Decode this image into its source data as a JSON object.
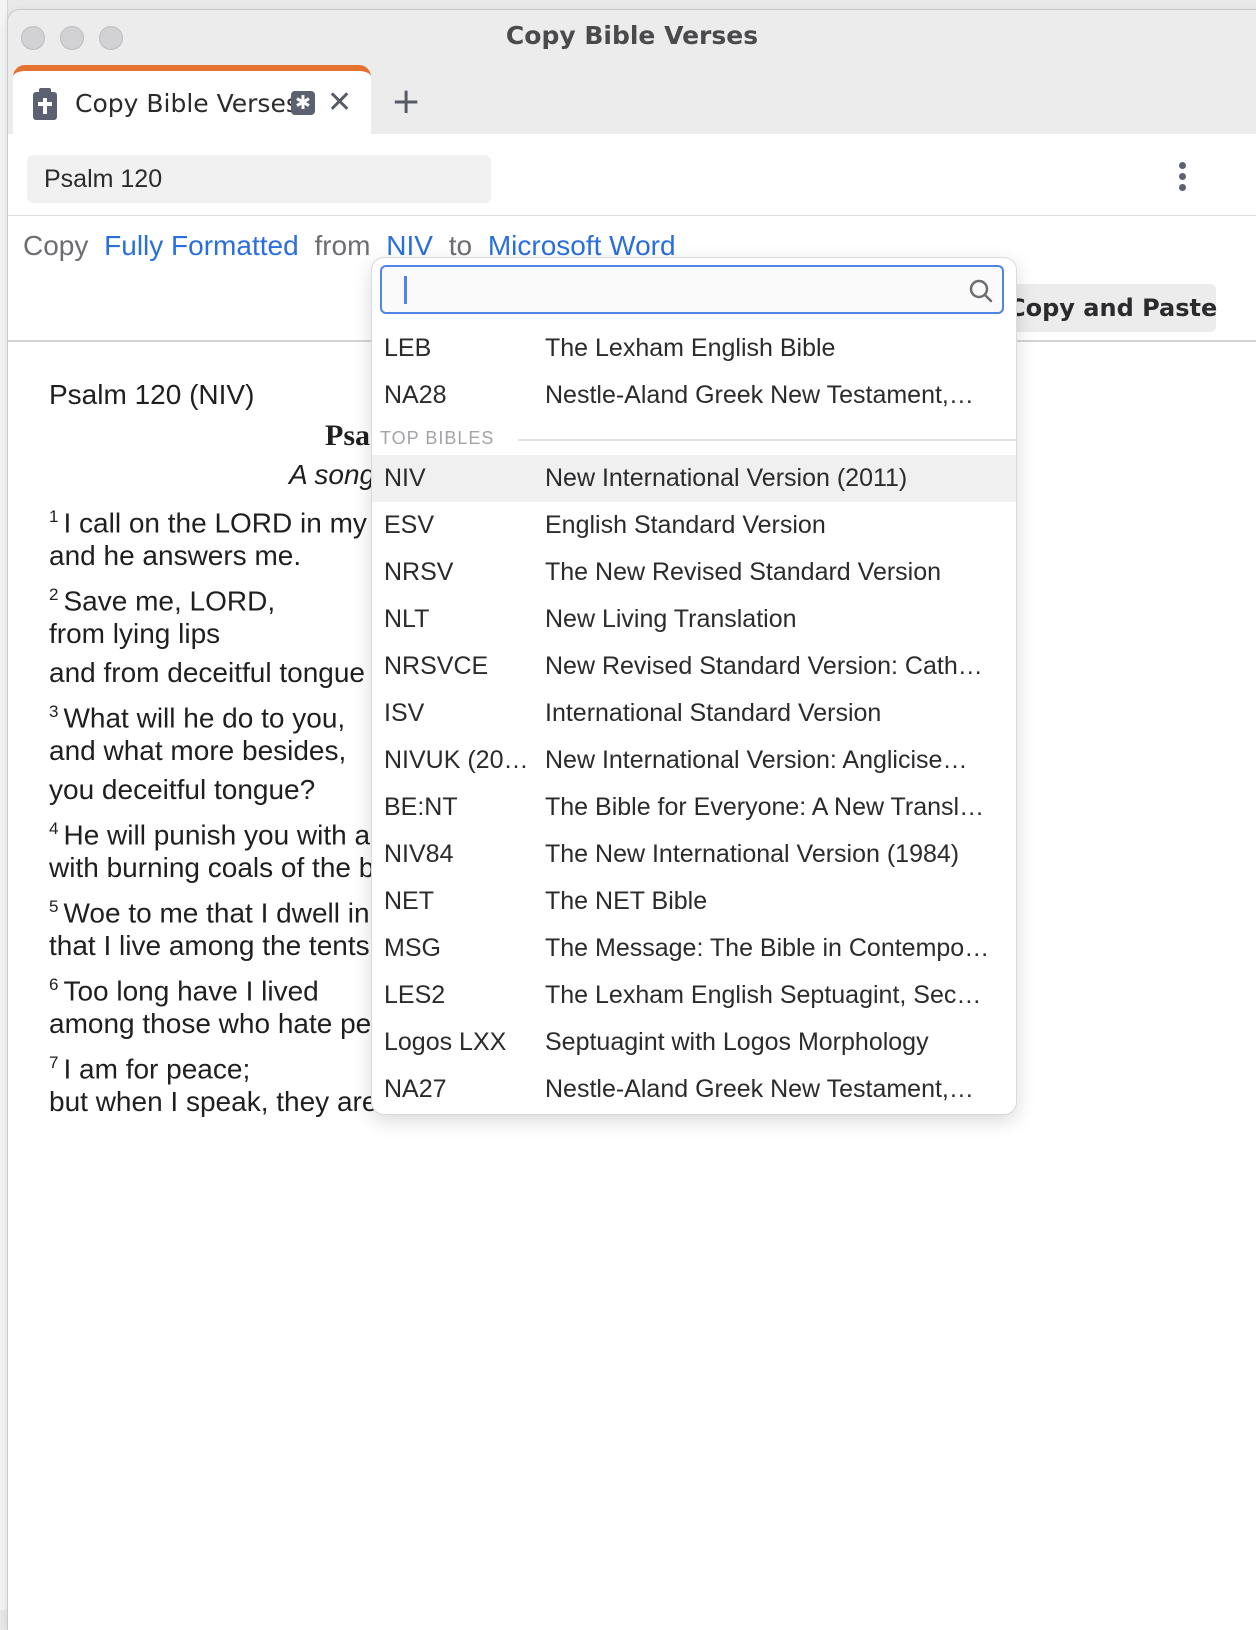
{
  "window": {
    "title": "Copy Bible Verses"
  },
  "tab": {
    "label": "Copy Bible Verses",
    "star_glyph": "✱",
    "close_glyph": "✕",
    "add_glyph": "+"
  },
  "reference_input": {
    "value": "Psalm 120"
  },
  "copy_sentence": {
    "copy": "Copy",
    "format": "Fully Formatted",
    "from": "from",
    "bible": "NIV",
    "to": "to",
    "target": "Microsoft Word"
  },
  "copy_paste_button": "Copy and Paste",
  "preview": {
    "reference": "Psalm 120 (NIV)",
    "heading": "Psa",
    "subtitle": "A song",
    "verses": [
      {
        "num": "1",
        "text": "I call on the LORD in my d"
      },
      {
        "num": "",
        "text": "and he answers me."
      },
      {
        "num": "2",
        "text": "Save me, LORD,"
      },
      {
        "num": "",
        "text": "from lying lips"
      },
      {
        "num": "",
        "text": "and from deceitful tongue"
      },
      {
        "num": "3",
        "text": "What will he do to you,"
      },
      {
        "num": "",
        "text": "and what more besides,"
      },
      {
        "num": "",
        "text": "you deceitful tongue?"
      },
      {
        "num": "4",
        "text": "He will punish you with a"
      },
      {
        "num": "",
        "text": "with burning coals of the b"
      },
      {
        "num": "5",
        "text": "Woe to me that I dwell in"
      },
      {
        "num": "",
        "text": "that I live among the tents"
      },
      {
        "num": "6",
        "text": "Too long have I lived"
      },
      {
        "num": "",
        "text": "among those who hate pe"
      },
      {
        "num": "7",
        "text": "I am for peace;"
      },
      {
        "num": "",
        "text": "but when I speak, they are"
      }
    ]
  },
  "dropdown": {
    "search_value": "",
    "recent": [
      {
        "abbrev": "LEB",
        "name": "The Lexham English Bible"
      },
      {
        "abbrev": "NA28",
        "name": "Nestle-Aland Greek New Testament,…"
      }
    ],
    "section_label": "TOP BIBLES",
    "top_bibles": [
      {
        "abbrev": "NIV",
        "name": "New International Version (2011)",
        "selected": true
      },
      {
        "abbrev": "ESV",
        "name": "English Standard Version"
      },
      {
        "abbrev": "NRSV",
        "name": "The New Revised Standard Version"
      },
      {
        "abbrev": "NLT",
        "name": "New Living Translation"
      },
      {
        "abbrev": "NRSVCE",
        "name": "New Revised Standard Version: Cath…"
      },
      {
        "abbrev": "ISV",
        "name": "International Standard Version"
      },
      {
        "abbrev": "NIVUK (20…",
        "name": "New International Version: Anglicise…"
      },
      {
        "abbrev": "BE:NT",
        "name": "The Bible for Everyone: A New Transl…"
      },
      {
        "abbrev": "NIV84",
        "name": "The New International Version (1984)"
      },
      {
        "abbrev": "NET",
        "name": "The NET Bible"
      },
      {
        "abbrev": "MSG",
        "name": "The Message: The Bible in Contempo…"
      },
      {
        "abbrev": "LES2",
        "name": "The Lexham English Septuagint, Sec…"
      },
      {
        "abbrev": "Logos LXX",
        "name": "Septuagint with Logos Morphology"
      },
      {
        "abbrev": "NA27",
        "name": "Nestle-Aland Greek New Testament,…"
      }
    ]
  },
  "colors": {
    "accent_link": "#2a6fdc",
    "tab_accent": "#e6722f",
    "focus_ring": "#4d86e6"
  }
}
